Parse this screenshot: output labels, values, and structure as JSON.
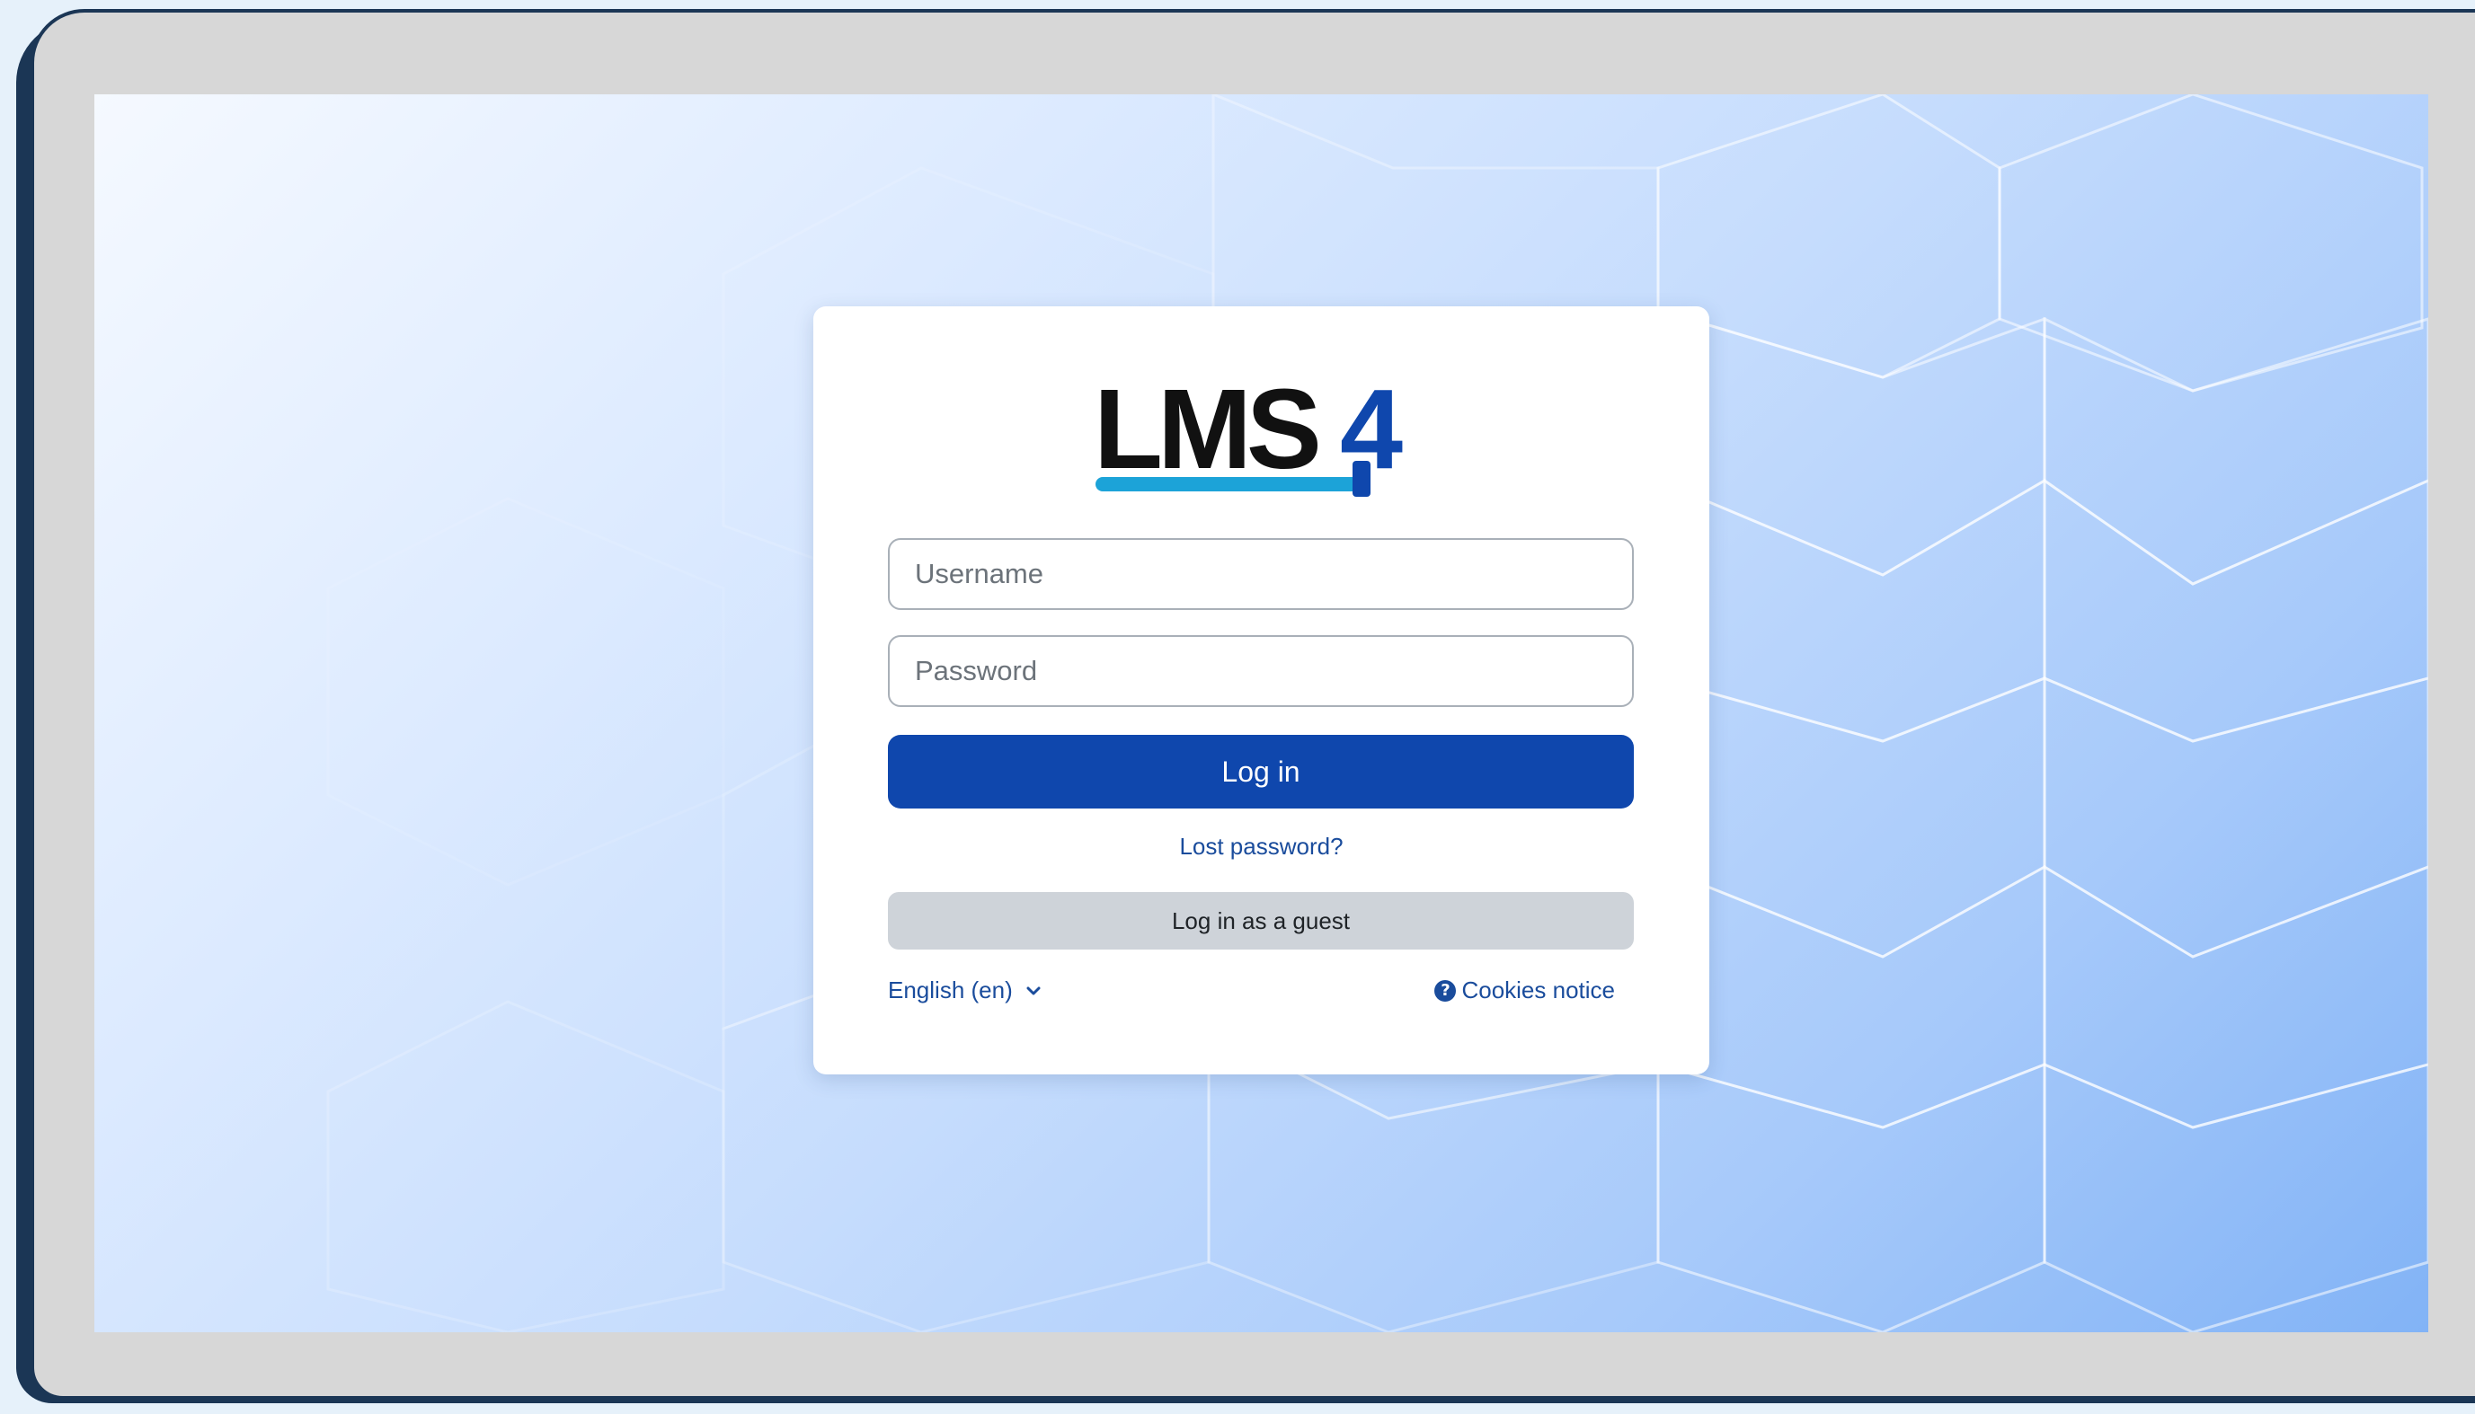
{
  "logo": {
    "text_lms": "LMS",
    "text_four": "4",
    "colors": {
      "text": "#111111",
      "accent": "#0f47ad",
      "underline": "#1ca3d8"
    }
  },
  "form": {
    "username_placeholder": "Username",
    "password_placeholder": "Password",
    "login_label": "Log in",
    "lost_password_label": "Lost password?",
    "guest_label": "Log in as a guest"
  },
  "footer": {
    "language_label": "English (en)",
    "language_icon": "chevron-down-icon",
    "cookies_icon": "question-circle-icon",
    "cookies_label": "Cookies notice"
  },
  "colors": {
    "primary": "#0f47ad",
    "link": "#1a4c9c",
    "secondary_button": "#ced3d9",
    "frame": "#1b3655",
    "bezel": "#d7d7d7"
  }
}
